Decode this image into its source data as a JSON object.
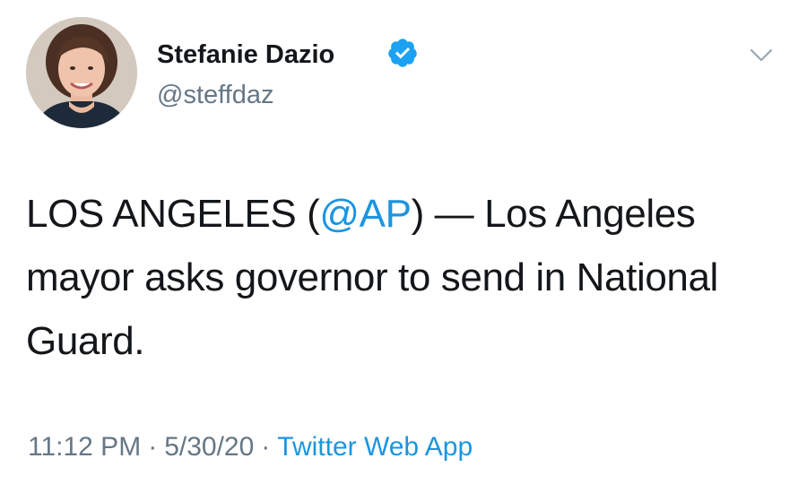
{
  "author": {
    "name": "Stefanie Dazio",
    "handle": "@steffdaz",
    "verified": true
  },
  "tweet": {
    "text_before": "LOS ANGELES (",
    "mention": "@AP",
    "text_after": ") — Los Angeles mayor asks governor to send in National Guard."
  },
  "meta": {
    "time": "11:12 PM",
    "separator": "·",
    "date": "5/30/20",
    "source": "Twitter Web App"
  },
  "icons": {
    "verified": "verified-badge-icon",
    "menu": "chevron-down-icon"
  },
  "colors": {
    "link": "#1b95e0",
    "secondary": "#657786",
    "text": "#14171a"
  }
}
